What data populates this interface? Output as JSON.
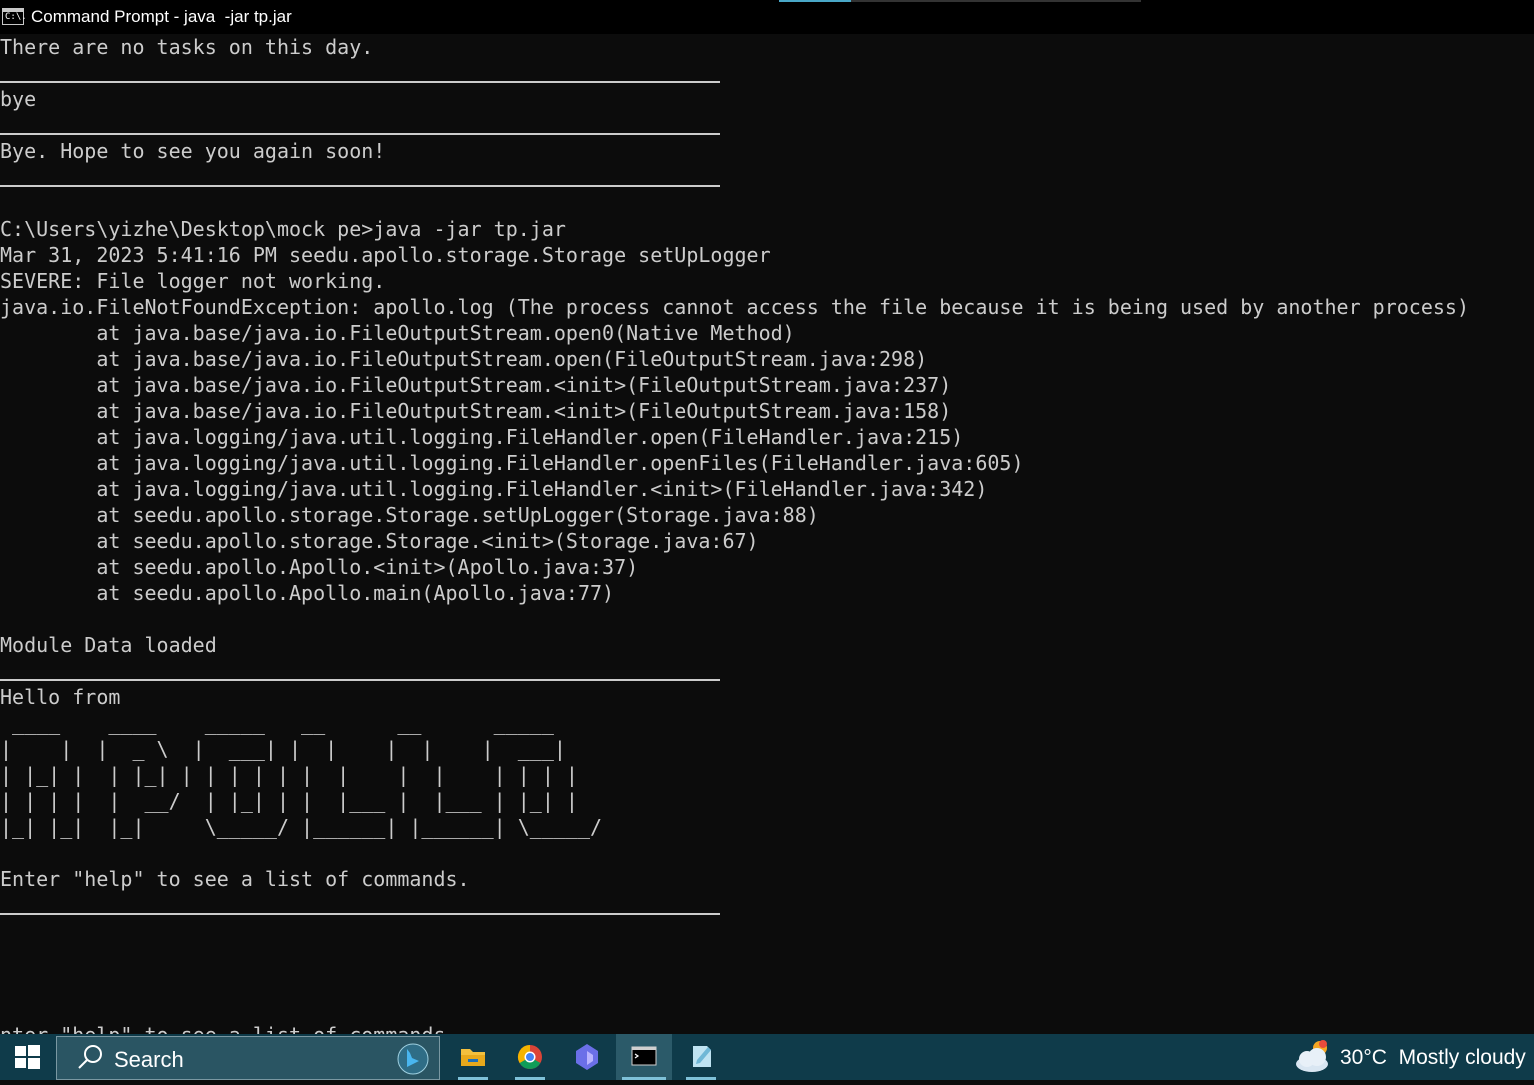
{
  "window": {
    "title": "Command Prompt - java  -jar tp.jar",
    "icon": "cmd-icon",
    "icon_text": "C:\\."
  },
  "console": {
    "lines": [
      "There are no tasks on this day.",
      "bye",
      "Bye. Hope to see you again soon!",
      "C:\\Users\\yizhe\\Desktop\\mock pe>java -jar tp.jar",
      "Mar 31, 2023 5:41:16 PM seedu.apollo.storage.Storage setUpLogger",
      "SEVERE: File logger not working.",
      "java.io.FileNotFoundException: apollo.log (The process cannot access the file because it is being used by another process)",
      "        at java.base/java.io.FileOutputStream.open0(Native Method)",
      "        at java.base/java.io.FileOutputStream.open(FileOutputStream.java:298)",
      "        at java.base/java.io.FileOutputStream.<init>(FileOutputStream.java:237)",
      "        at java.base/java.io.FileOutputStream.<init>(FileOutputStream.java:158)",
      "        at java.logging/java.util.logging.FileHandler.open(FileHandler.java:215)",
      "        at java.logging/java.util.logging.FileHandler.openFiles(FileHandler.java:605)",
      "        at java.logging/java.util.logging.FileHandler.<init>(FileHandler.java:342)",
      "        at seedu.apollo.storage.Storage.setUpLogger(Storage.java:88)",
      "        at seedu.apollo.storage.Storage.<init>(Storage.java:67)",
      "        at seedu.apollo.Apollo.<init>(Apollo.java:37)",
      "        at seedu.apollo.Apollo.main(Apollo.java:77)",
      "Module Data loaded",
      "Hello from",
      " ____    ____    _____   __      __      _____",
      "|    |  |  _ \\  |  ___| |  |    |  |    |  ___|",
      "| |_| |  | |_| | | | | | |  |    |  |    | | | |",
      "| | | |  |  __/  | |_| | |  |___ |  |___ | |_| |",
      "|_| |_|  |_|     \\_____/ |______| |______| \\_____/",
      "Enter \"help\" to see a list of commands.",
      "nter \"help\" to see a list of commands."
    ]
  },
  "taskbar": {
    "start_icon": "windows-logo-icon",
    "search_placeholder": "Search",
    "search_icon": "search-icon",
    "bing_icon": "bing-icon",
    "apps": [
      {
        "name": "file-explorer-icon"
      },
      {
        "name": "chrome-icon"
      },
      {
        "name": "copilot-icon"
      },
      {
        "name": "command-prompt-icon"
      },
      {
        "name": "notepad-icon"
      }
    ],
    "weather": {
      "temp": "30°C",
      "condition": "Mostly cloudy",
      "icon": "cloudy-weather-icon"
    }
  },
  "colors": {
    "console_bg": "#0c0c0c",
    "console_fg": "#cccccc",
    "taskbar_bg": "#0f3b4a",
    "accent": "#7fc1d8"
  }
}
